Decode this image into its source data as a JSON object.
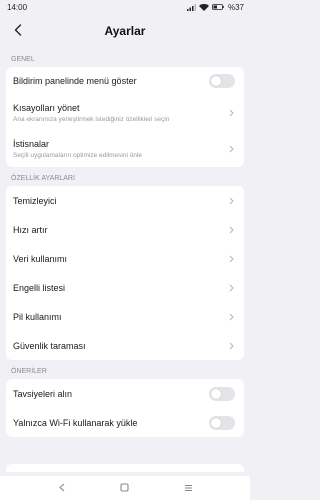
{
  "status": {
    "time": "14:00",
    "battery": "%37"
  },
  "header": {
    "title": "Ayarlar"
  },
  "sections": {
    "general": {
      "label": "GENEL",
      "items": [
        {
          "title": "Bildirim panelinde menü göster"
        },
        {
          "title": "Kısayolları yönet",
          "subtitle": "Ana ekranınıza yerleştirmek istediğiniz özellikleri seçin"
        },
        {
          "title": "İstisnalar",
          "subtitle": "Seçili uygulamaların optimize edilmesini önle"
        }
      ]
    },
    "features": {
      "label": "ÖZELLİK AYARLARI",
      "items": [
        {
          "title": "Temizleyici"
        },
        {
          "title": "Hızı artır"
        },
        {
          "title": "Veri kullanımı"
        },
        {
          "title": "Engelli listesi"
        },
        {
          "title": "Pil kullanımı"
        },
        {
          "title": "Güvenlik taraması"
        }
      ]
    },
    "suggestions": {
      "label": "ÖNERİLER",
      "items": [
        {
          "title": "Tavsiyeleri alın"
        },
        {
          "title": "Yalnızca Wi-Fi kullanarak yükle"
        }
      ]
    }
  }
}
